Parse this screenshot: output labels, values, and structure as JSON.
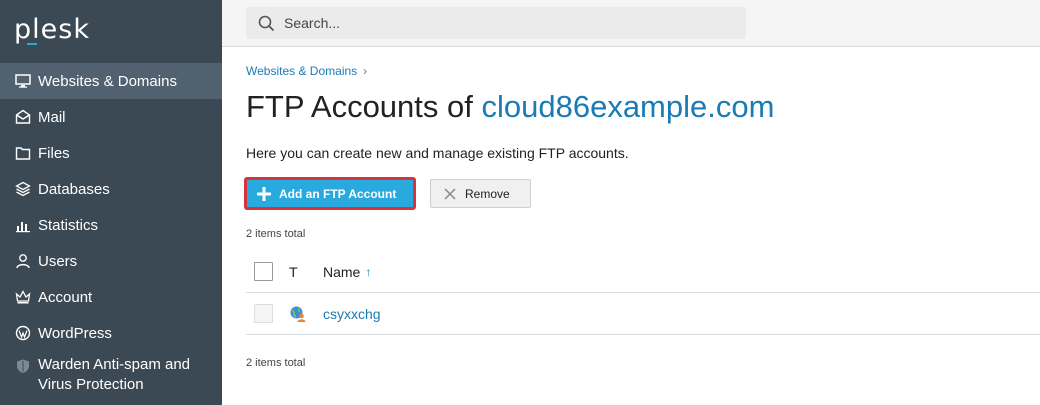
{
  "brand": {
    "logo_text": "plesk",
    "accent_color": "#28aade",
    "sidebar_color": "#3b4954"
  },
  "search": {
    "placeholder": "Search..."
  },
  "sidebar": {
    "items": [
      {
        "label": "Websites & Domains",
        "icon": "monitor-icon",
        "active": true
      },
      {
        "label": "Mail",
        "icon": "mail-icon"
      },
      {
        "label": "Files",
        "icon": "folder-icon"
      },
      {
        "label": "Databases",
        "icon": "database-icon"
      },
      {
        "label": "Statistics",
        "icon": "bar-chart-icon"
      },
      {
        "label": "Users",
        "icon": "user-icon"
      },
      {
        "label": "Account",
        "icon": "crown-icon"
      },
      {
        "label": "WordPress",
        "icon": "wordpress-icon"
      },
      {
        "label": "Warden Anti-spam and Virus Protection",
        "icon": "shield-icon"
      }
    ]
  },
  "breadcrumb": {
    "item": "Websites & Domains",
    "separator": "›"
  },
  "page": {
    "title_prefix": "FTP Accounts of ",
    "title_domain": "cloud86example.com",
    "description": "Here you can create new and manage existing FTP accounts."
  },
  "toolbar": {
    "add_label": "Add an FTP Account",
    "remove_label": "Remove"
  },
  "list": {
    "count_top": "2 items total",
    "count_bottom": "2 items total",
    "columns": {
      "type": "T",
      "name": "Name",
      "sort_indicator": "↑"
    },
    "rows": [
      {
        "name": "csyxxchg",
        "icon": "ftp-user-icon"
      }
    ]
  }
}
